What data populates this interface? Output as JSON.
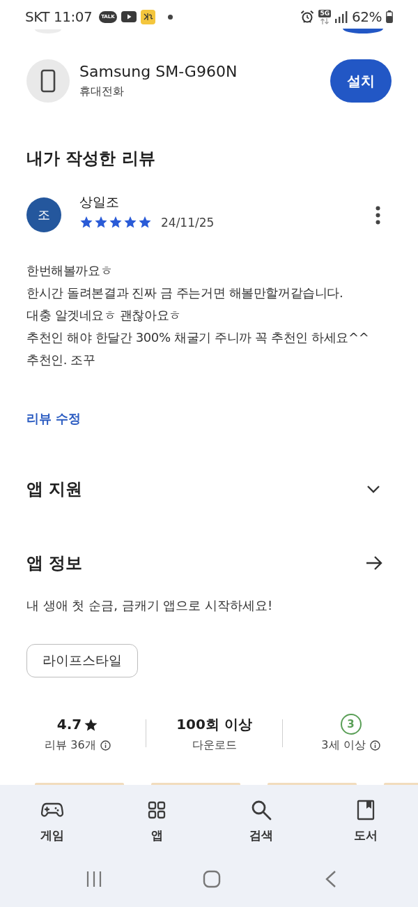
{
  "status_bar": {
    "carrier": "SKT",
    "time": "11:07",
    "notifications": [
      {
        "kind": "chat",
        "label": "TALK"
      },
      {
        "kind": "video"
      },
      {
        "kind": "app"
      }
    ],
    "network": "5G",
    "battery": "62%"
  },
  "device": {
    "name": "Samsung SM-G960N",
    "type": "휴대전화",
    "button": "설치"
  },
  "my_review": {
    "title": "내가 작성한 리뷰",
    "initial": "조",
    "author": "상일조",
    "stars": 5,
    "date": "24/11/25",
    "text": "한번해볼까요ㅎ\n한시간 돌려본결과 진짜 금 주는거면 해볼만할꺼같습니다.\n대충 알겟네요ㅎ 괜찮아요ㅎ\n추천인 해야 한달간 300% 채굴기 주니까 꼭 추천인 하세요^^\n추천인. 조꾸",
    "edit_link": "리뷰 수정"
  },
  "app_support": {
    "title": "앱 지원",
    "expanded": false
  },
  "app_info": {
    "title": "앱 정보",
    "description": "내 생애 첫 순금, 금캐기 앱으로 시작하세요!",
    "category": "라이프스타일"
  },
  "stats": [
    {
      "kind": "rating",
      "value": "4.7",
      "label": "리뷰 36개",
      "info": true
    },
    {
      "kind": "count",
      "value": "100회 이상",
      "label": "다운로드",
      "info": false
    },
    {
      "kind": "age",
      "value": "3",
      "label": "3세 이상",
      "info": true
    }
  ],
  "bottom_nav": [
    {
      "kind": "games",
      "label": "게임"
    },
    {
      "kind": "apps",
      "label": "앱"
    },
    {
      "kind": "search",
      "label": "검색"
    },
    {
      "kind": "books",
      "label": "도서"
    }
  ]
}
